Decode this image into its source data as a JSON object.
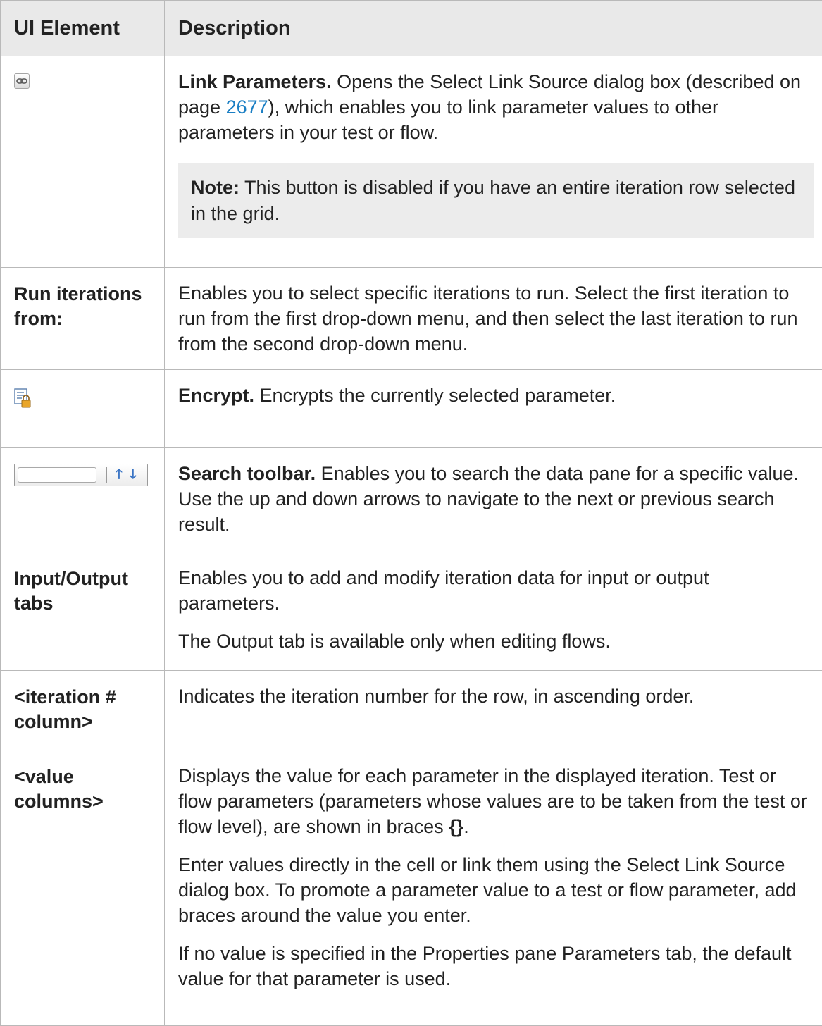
{
  "header": {
    "col1": "UI Element",
    "col2": "Description"
  },
  "rows": {
    "link_params": {
      "icon": "link-icon",
      "title": "Link Parameters.",
      "text_a": " Opens the Select Link Source dialog box (described on page ",
      "page_link": "2677",
      "text_b": "), which enables you to link parameter values to other parameters in your test or flow.",
      "note_label": "Note:",
      "note_text": " This button is disabled if you have an entire iteration row selected in the grid."
    },
    "run_iterations": {
      "element": "Run iterations from:",
      "text": "Enables you to select specific iterations to run. Select the first iteration to run from the first drop-down menu, and then select the last iteration to run from the second drop-down menu."
    },
    "encrypt": {
      "icon": "encrypt-document-lock-icon",
      "title": "Encrypt.",
      "text": " Encrypts the currently selected parameter."
    },
    "search": {
      "up_arrow": "🡑",
      "down_arrow": "🡓",
      "title": "Search toolbar.",
      "text": " Enables you to search the data pane for a specific value. Use the up and down arrows to navigate to the next or previous search result."
    },
    "io_tabs": {
      "element": "Input/Output tabs",
      "text_1": "Enables you to add and modify iteration data for input or output parameters.",
      "text_2": "The Output tab is available only when editing flows."
    },
    "iteration_col": {
      "element": "<iteration # column>",
      "text": "Indicates the iteration number for the row, in ascending order."
    },
    "value_cols": {
      "element": "<value columns>",
      "text_1a": "Displays the value for each parameter in the displayed iteration.  Test or flow parameters (parameters whose values are to be taken from the test or flow level), are shown in braces ",
      "braces": "{}",
      "text_1b": ".",
      "text_2": "Enter values directly in the cell or link them using the Select Link Source dialog box. To promote a parameter value to a test or flow parameter, add braces around the value you enter.",
      "text_3": "If no value is specified in the Properties pane Parameters tab, the default value for that parameter is used."
    }
  }
}
